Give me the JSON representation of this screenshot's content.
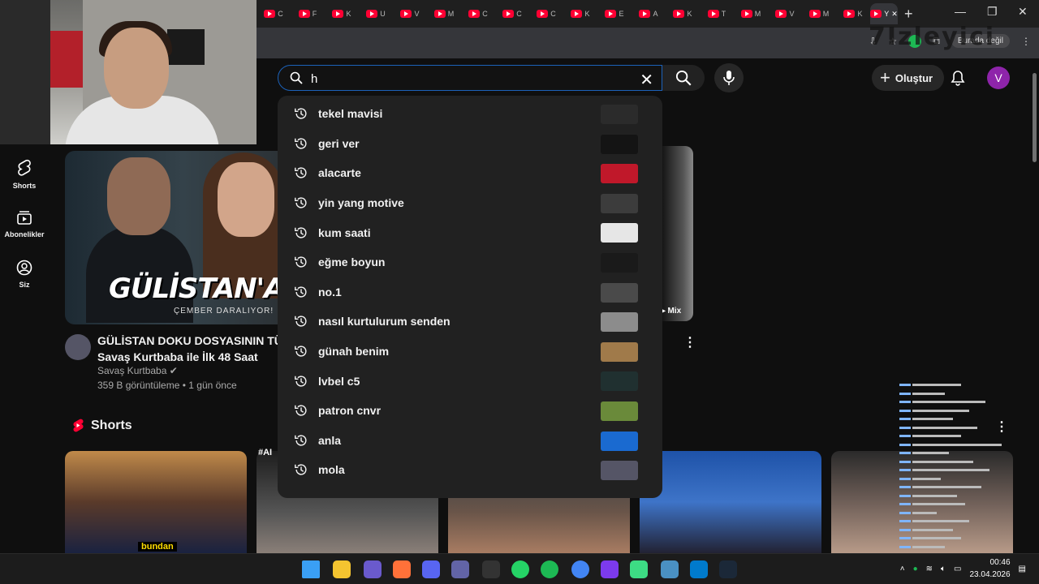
{
  "tabs": [
    "C",
    "F",
    "K",
    "U",
    "V",
    "M",
    "C",
    "C",
    "C",
    "K",
    "E",
    "A",
    "K",
    "T",
    "M",
    "V",
    "M",
    "K",
    "Y"
  ],
  "search": {
    "value": "h",
    "suggestions": [
      {
        "text": "tekel mavisi",
        "thumb": "#2b2b2b"
      },
      {
        "text": "geri ver",
        "thumb": "#141414"
      },
      {
        "text": "alacarte",
        "thumb": "#c0182a"
      },
      {
        "text": "yin yang motive",
        "thumb": "#3c3c3c"
      },
      {
        "text": "kum saati",
        "thumb": "#e6e6e6"
      },
      {
        "text": "eğme boyun",
        "thumb": "#1a1a1a"
      },
      {
        "text": "no.1",
        "thumb": "#4a4a4a"
      },
      {
        "text": "nasıl kurtulurum senden",
        "thumb": "#8c8c8c"
      },
      {
        "text": "günah benim",
        "thumb": "#a07a4a"
      },
      {
        "text": "lvbel c5",
        "thumb": "#203030"
      },
      {
        "text": "patron cnvr",
        "thumb": "#6a8a3a"
      },
      {
        "text": "anla",
        "thumb": "#1a6ad0"
      },
      {
        "text": "mola",
        "thumb": "#556"
      }
    ]
  },
  "header": {
    "create_label": "Oluştur",
    "avatar_letter": "V",
    "profile_chip": "Burada değil",
    "watermark": "7Izleyici"
  },
  "guide": {
    "shorts": "Shorts",
    "subscriptions": "Abonelikler",
    "you": "Siz"
  },
  "video": {
    "thumb_title": "GÜLİSTAN'A NE O",
    "thumb_subtitle": "ÇEMBER DARALIYOR!",
    "title_line1": "GÜLİSTAN DOKU DOSYASININ TÜM D",
    "title_line2": "Savaş Kurtbaba ile İlk 48 Saat",
    "channel": "Savaş Kurtbaba",
    "stats": "359 B görüntüleme • 1 gün önce"
  },
  "mix_label": "Mix",
  "shorts": {
    "heading": "Shorts",
    "short1_caption": "bundan",
    "short2_tag": "#AI"
  },
  "taskbar": {
    "time": "00:46",
    "date": "23.04.2026"
  },
  "colors": {
    "accent_blue": "#1c62b9",
    "youtube_red": "#ff0033",
    "avatar_purple": "#8e24aa"
  }
}
